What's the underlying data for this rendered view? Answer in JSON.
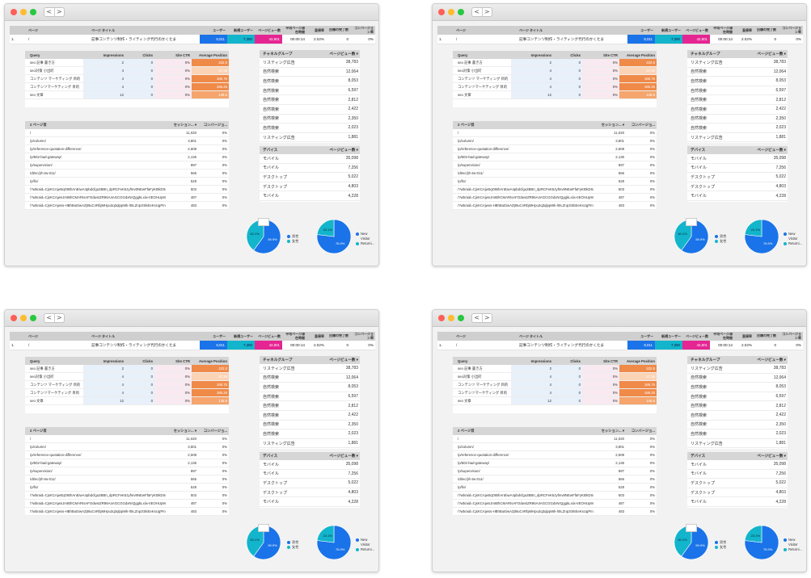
{
  "windows": [
    {
      "nav_back": "<",
      "nav_forward": ">"
    },
    {
      "nav_back": "<",
      "nav_forward": ">"
    },
    {
      "nav_back": "<",
      "nav_forward": ">"
    },
    {
      "nav_back": "<",
      "nav_forward": ">"
    }
  ],
  "top_table": {
    "headers": [
      "ページ",
      "ページ タイトル",
      "ユーザー",
      "新規ユーザー",
      "ページビュー数",
      "平均ページ滞在時間",
      "直帰率",
      "目標の完了数",
      "コンバージョン率"
    ],
    "row": {
      "index": "1.",
      "page": "/",
      "title": "記事コンテンツ制作・ライティング代行のかくたま",
      "users": "8,011",
      "new_users": "7,350",
      "pageviews": "42,801",
      "avg_time": "00:00:14",
      "bounce": "2.02%",
      "goals": "0",
      "conv": "0%"
    },
    "colors": {
      "users": "#1a73e8",
      "new_users": "#12b5cb",
      "pageviews": "#e52592"
    }
  },
  "query_table": {
    "headers": [
      "Query",
      "Impressions",
      "Clicks",
      "Site CTR",
      "Average Position"
    ],
    "rows": [
      {
        "query": "seo 記事 書き方",
        "impressions": "2",
        "clicks": "0",
        "ctr": "0%",
        "position": "222.5"
      },
      {
        "query": "seo対策 小出町",
        "impressions": "4",
        "clicks": "0",
        "ctr": "0%",
        "position": "27.25"
      },
      {
        "query": "コンテンツ マーケティング 目的",
        "impressions": "4",
        "clicks": "0",
        "ctr": "0%",
        "position": "188.75"
      },
      {
        "query": "コンテンツマーケティング 目的",
        "impressions": "4",
        "clicks": "0",
        "ctr": "0%",
        "position": "185.25"
      },
      {
        "query": "seo 文章",
        "impressions": "12",
        "clicks": "0",
        "ctr": "0%",
        "position": "145.5"
      }
    ]
  },
  "page2_table": {
    "headers": [
      "2 ページ目",
      "セッション... ▾",
      "コンバージョ..."
    ],
    "rows": [
      {
        "path": "/",
        "sessions": "11,020",
        "conv": "0%"
      },
      {
        "path": "/p/column/",
        "sessions": "3,801",
        "conv": "0%"
      },
      {
        "path": "/p/reference-quotation-difference/",
        "sessions": "2,608",
        "conv": "0%"
      },
      {
        "path": "/p/502-bad-gateway/",
        "sessions": "2,136",
        "conv": "0%"
      },
      {
        "path": "/p/supervision/",
        "sessions": "897",
        "conv": "0%"
      },
      {
        "path": "/dt/ec/jrh-tw-011/",
        "sessions": "566",
        "conv": "0%"
      },
      {
        "path": "/p/fix/",
        "sessions": "528",
        "conv": "0%"
      },
      {
        "path": "/?wbraid=CjsKCAjw0qOIBhAnEiwA4pbdcfgu2BBII_dpRCFeK5Jyfmv8NEwFfaFyKt0kDSqJuSsxl...",
        "sessions": "503",
        "conv": "0%"
      },
      {
        "path": "/?wbraid=CjsKCAjwnJmIBhCMARIsAFOdwsIZR96A4AGCGGdxNrQggkLxiix-IIEOHUp9nCPbnsN...",
        "sessions": "487",
        "conv": "0%"
      },
      {
        "path": "/?wbraid=CjsKCAjwss-HBhBuEiwAZj9tuCnRbjMHpu3q3qlppWk-l0ILZnpztSkEeKsUgPmbnrTlTlB...",
        "sessions": "483",
        "conv": "0%"
      }
    ]
  },
  "channel_table": {
    "headers": [
      "チャネルグループ",
      "ページビュー数 ▾"
    ],
    "rows": [
      {
        "name": "リスティング広告",
        "value": "38,783"
      },
      {
        "name": "自然検索",
        "value": "12,064"
      },
      {
        "name": "自然検索",
        "value": "8,053"
      },
      {
        "name": "自然検索",
        "value": "6,597"
      },
      {
        "name": "自然検索",
        "value": "2,812"
      },
      {
        "name": "自然検索",
        "value": "2,422"
      },
      {
        "name": "自然検索",
        "value": "2,350"
      },
      {
        "name": "自然検索",
        "value": "2,023"
      },
      {
        "name": "リスティング広告",
        "value": "1,881"
      }
    ]
  },
  "device_table": {
    "headers": [
      "デバイス",
      "ページビュー数 ▾"
    ],
    "rows": [
      {
        "name": "モバイル",
        "value": "35,098"
      },
      {
        "name": "モバイル",
        "value": "7,256"
      },
      {
        "name": "デスクトップ",
        "value": "5,022"
      },
      {
        "name": "デスクトップ",
        "value": "4,803"
      },
      {
        "name": "モバイル",
        "value": "4,228"
      }
    ]
  },
  "pie1": {
    "slices": [
      {
        "label": "男性",
        "pct": 59.9,
        "color": "#1a73e8"
      },
      {
        "label": "女性",
        "pct": 40.1,
        "color": "#12b5cb"
      }
    ],
    "labels": [
      "40.1%",
      "59.9%"
    ]
  },
  "pie2": {
    "slices": [
      {
        "label": "New Visitor",
        "pct": 76.9,
        "color": "#1a73e8"
      },
      {
        "label": "Returning...",
        "pct": 23.1,
        "color": "#12b5cb"
      }
    ],
    "labels": [
      "23.1%",
      "76.9%"
    ],
    "legend": [
      "New",
      "Visitor",
      "Returni..."
    ]
  }
}
